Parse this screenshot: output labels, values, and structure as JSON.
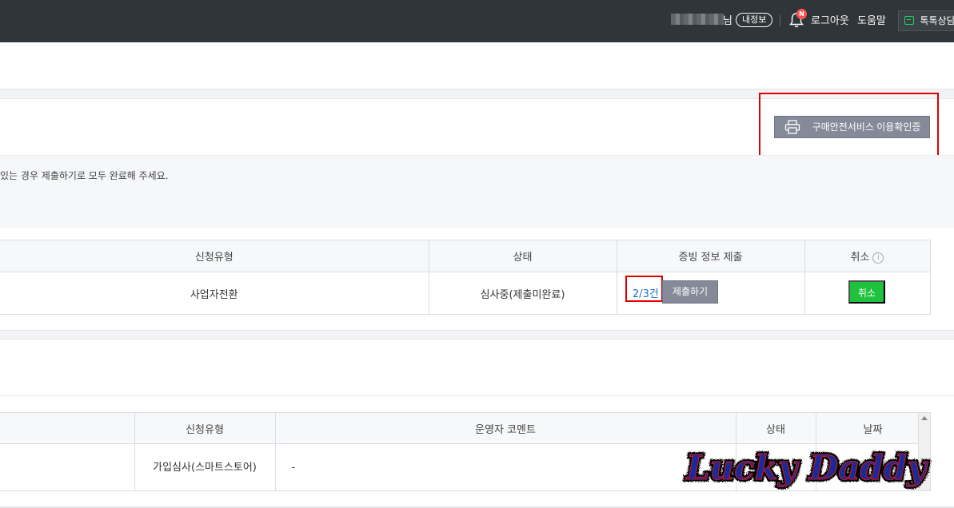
{
  "header": {
    "user_suffix": "님",
    "my_info_label": "내정보",
    "notification_badge": "N",
    "logout_label": "로그아웃",
    "help_label": "도움말",
    "talk_label": "톡톡상담"
  },
  "toolbar": {
    "print_certificate_label": "구매안전서비스 이용확인증"
  },
  "notice": {
    "text": "있는 경우 제출하기로 모두 완료해 주세요."
  },
  "application_table": {
    "headers": {
      "type": "신청유형",
      "status": "상태",
      "evidence": "증빙 정보 제출",
      "cancel": "취소"
    },
    "row": {
      "type": "사업자전환",
      "status": "심사중(제출미완료)",
      "evidence_count": "2/3건",
      "submit_label": "제출하기",
      "cancel_label": "취소"
    }
  },
  "history_table": {
    "headers": {
      "type": "신청유형",
      "comment": "운영자 코멘트",
      "status": "상태",
      "date": "날짜"
    },
    "row": {
      "type": "가입심사(스마트스토어)",
      "comment": "-"
    }
  },
  "watermark": "Lucky Daddy",
  "colors": {
    "topbar": "#2f3539",
    "gray_button": "#848a98",
    "cancel_green": "#1ec23c",
    "highlight_red": "#e00000",
    "link_blue": "#1a73c5"
  }
}
